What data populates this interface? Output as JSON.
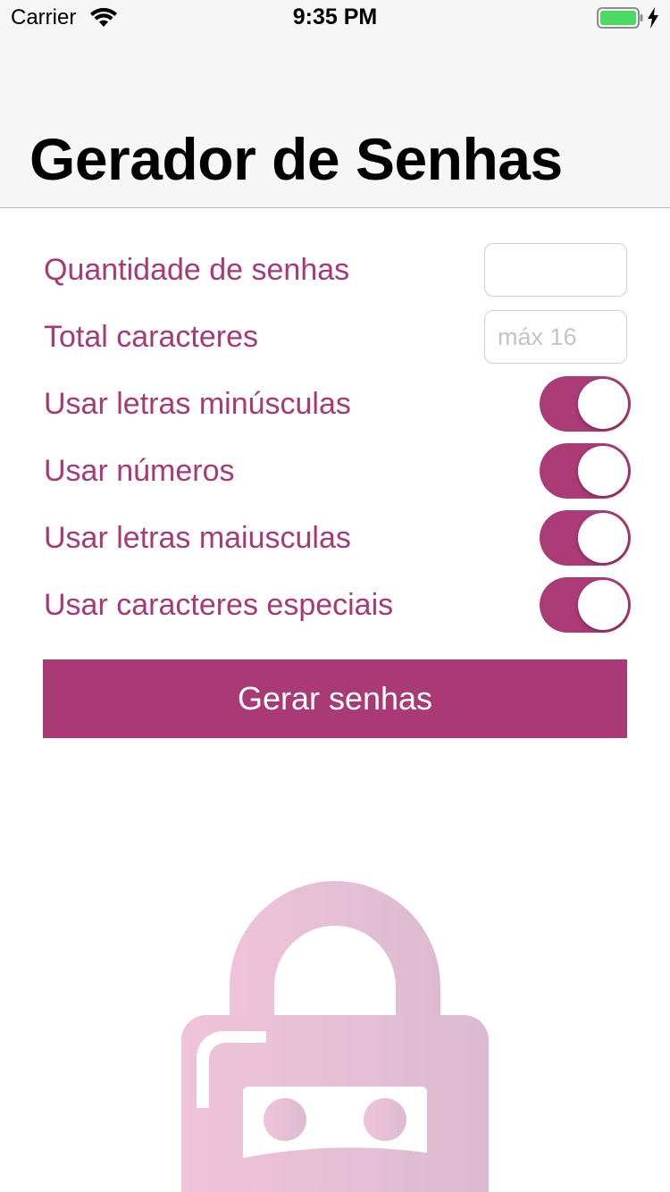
{
  "status_bar": {
    "carrier": "Carrier",
    "time": "9:35 PM",
    "battery_color": "#4cd964"
  },
  "nav": {
    "title": "Gerador de Senhas"
  },
  "form": {
    "quantity_label": "Quantidade de senhas",
    "quantity_value": "",
    "total_chars_label": "Total caracteres",
    "total_chars_placeholder": "máx 16",
    "toggles": [
      {
        "label": "Usar letras minúsculas",
        "on": true
      },
      {
        "label": "Usar números",
        "on": true
      },
      {
        "label": "Usar letras maiusculas",
        "on": true
      },
      {
        "label": "Usar caracteres especiais",
        "on": true
      }
    ],
    "generate_button": "Gerar senhas"
  },
  "colors": {
    "accent": "#aa3a76",
    "label": "#a73a76",
    "illustration_left": "#efc3d9",
    "illustration_right": "#dcbbd1"
  },
  "illustration": {
    "icon": "lock-icon"
  }
}
